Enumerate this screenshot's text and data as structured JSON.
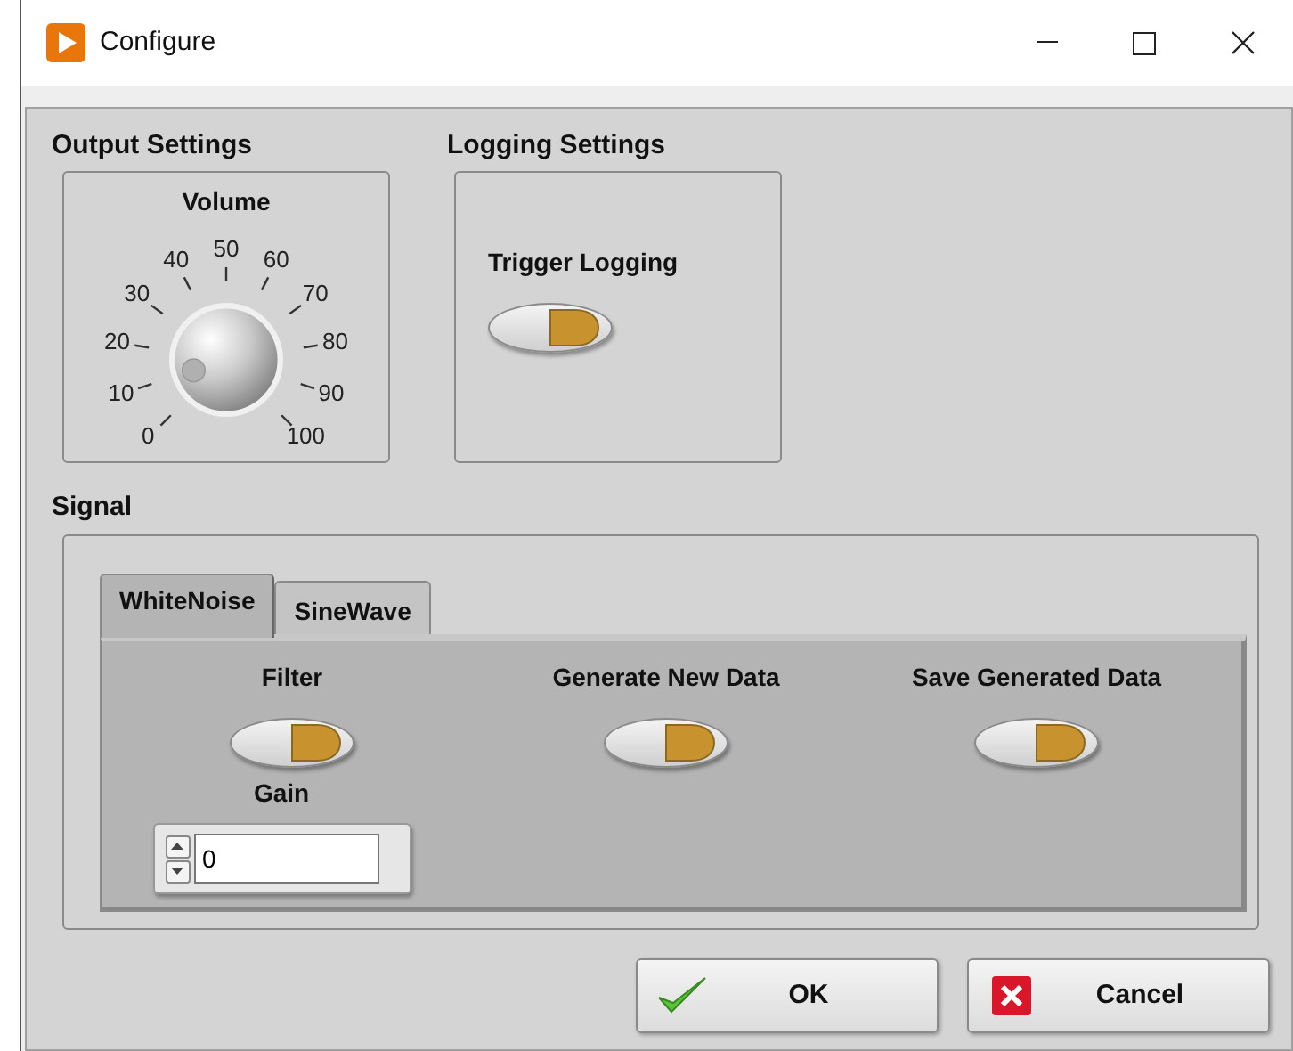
{
  "window": {
    "title": "Configure"
  },
  "output_settings": {
    "title": "Output Settings",
    "volume": {
      "label": "Volume",
      "ticks": [
        "0",
        "10",
        "20",
        "30",
        "40",
        "50",
        "60",
        "70",
        "80",
        "90",
        "100"
      ]
    }
  },
  "logging_settings": {
    "title": "Logging Settings",
    "trigger_logging": {
      "label": "Trigger Logging",
      "on": true
    }
  },
  "signal": {
    "title": "Signal",
    "tabs": [
      {
        "label": "WhiteNoise",
        "selected": true
      },
      {
        "label": "SineWave",
        "selected": false
      }
    ],
    "switches": [
      {
        "label": "Filter",
        "on": true
      },
      {
        "label": "Generate New Data",
        "on": true
      },
      {
        "label": "Save Generated Data",
        "on": true
      }
    ],
    "gain": {
      "label": "Gain",
      "value": "0"
    }
  },
  "buttons": [
    {
      "kind": "ok",
      "label": "OK"
    },
    {
      "kind": "cancel",
      "label": "Cancel"
    }
  ]
}
